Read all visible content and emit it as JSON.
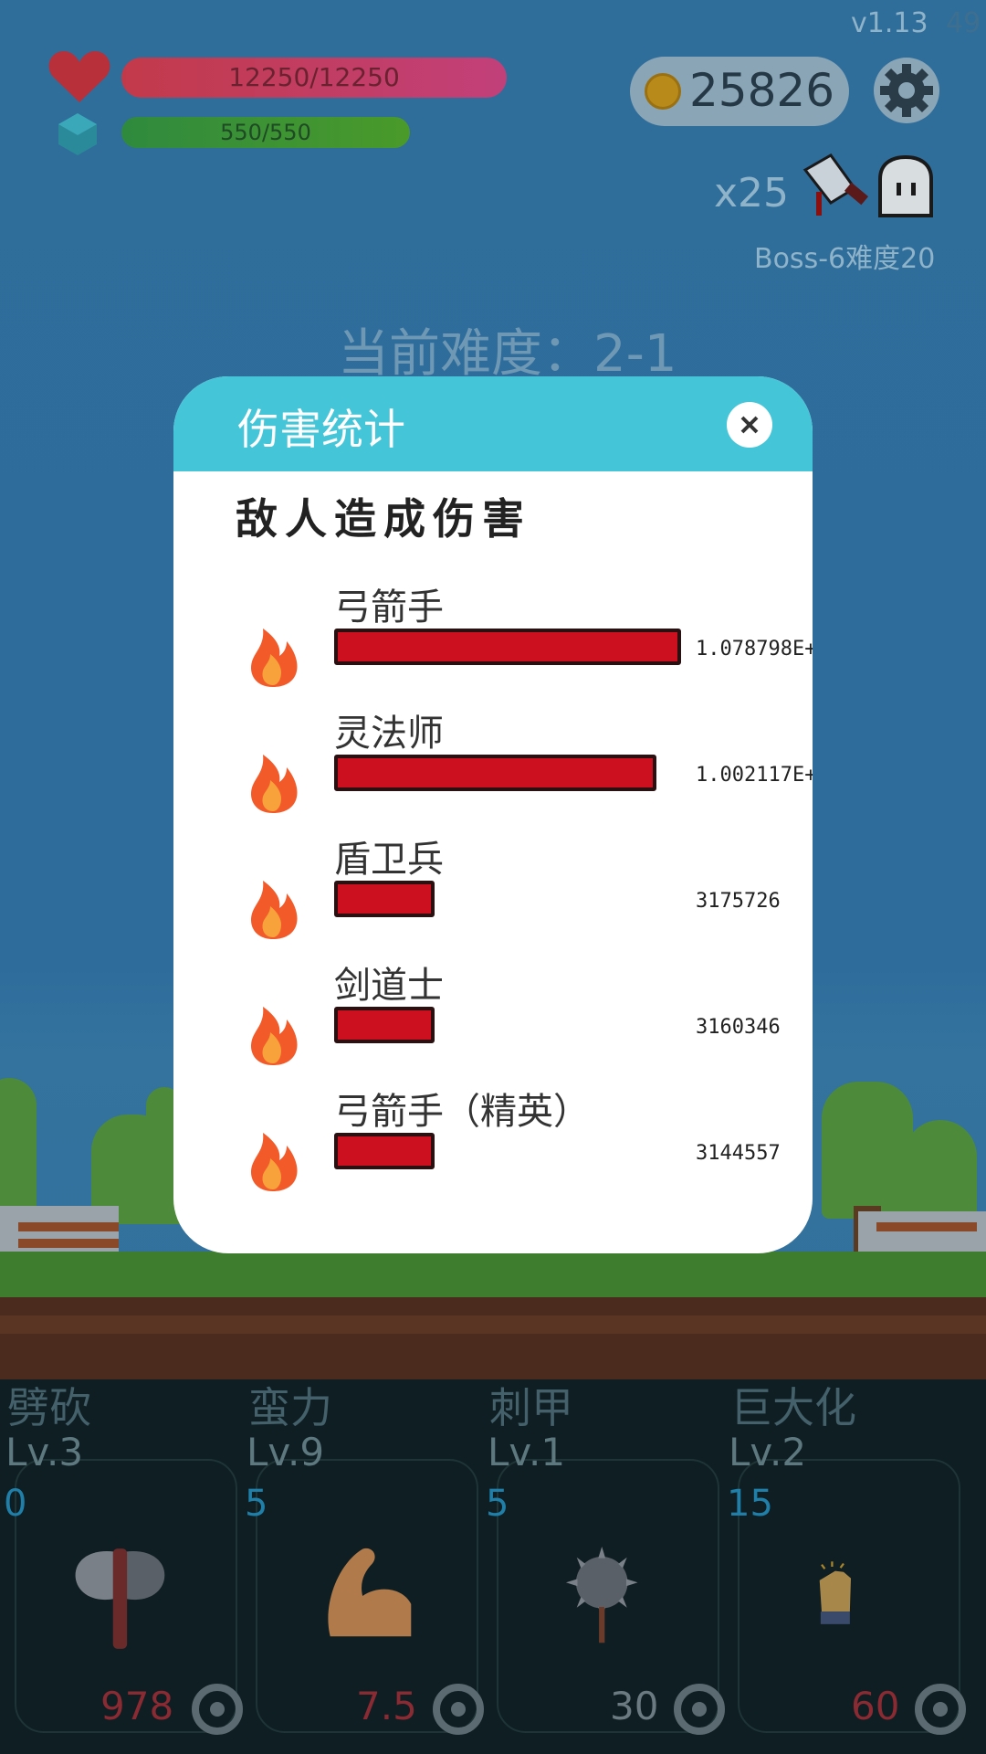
{
  "hud": {
    "version": "v1.13",
    "version_extra": "49",
    "hp": "12250/12250",
    "mp": "550/550",
    "coins": "25826",
    "kills": "x25",
    "boss_label": "Boss-6难度20",
    "current_difficulty": "当前难度：2-1"
  },
  "modal": {
    "title": "伤害统计",
    "section_title": "敌人造成伤害",
    "rows": [
      {
        "name": "弓箭手",
        "value": "1.078798E+",
        "fill": 1.0
      },
      {
        "name": "灵法师",
        "value": "1.002117E+",
        "fill": 0.93
      },
      {
        "name": "盾卫兵",
        "value": "3175726",
        "fill": 0.29
      },
      {
        "name": "剑道士",
        "value": "3160346",
        "fill": 0.29
      },
      {
        "name": "弓箭手（精英）",
        "value": "3144557",
        "fill": 0.29
      }
    ]
  },
  "skills": [
    {
      "name": "劈砍",
      "level": "Lv.3",
      "count": "0",
      "cost": "978",
      "cost_color": "#8a2a32",
      "icon": "axe-icon"
    },
    {
      "name": "蛮力",
      "level": "Lv.9",
      "count": "5",
      "cost": "7.5",
      "cost_color": "#8a2a32",
      "icon": "muscle-icon"
    },
    {
      "name": "刺甲",
      "level": "Lv.1",
      "count": "5",
      "cost": "30",
      "cost_color": "#6a7a80",
      "icon": "spiked-mace-icon"
    },
    {
      "name": "巨大化",
      "level": "Lv.2",
      "count": "15",
      "cost": "60",
      "cost_color": "#8a2a32",
      "icon": "fist-icon"
    }
  ],
  "colors": {
    "modal_header": "#44c6d8",
    "damage_bar": "#cc1020",
    "sky": "#2f6d9b"
  }
}
